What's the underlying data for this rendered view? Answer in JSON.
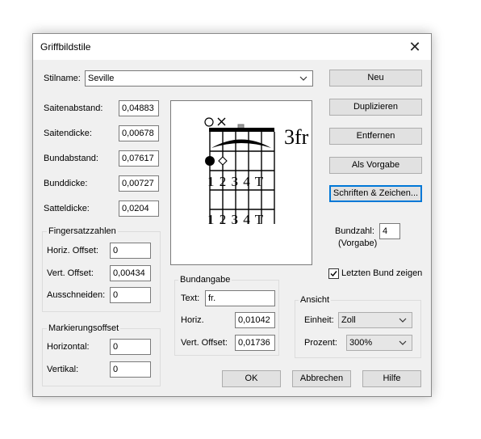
{
  "window": {
    "title": "Griffbildstile"
  },
  "style_name": {
    "label": "Stilname:",
    "value": "Seville"
  },
  "metrics": [
    {
      "label": "Saitenabstand:",
      "value": "0,04883"
    },
    {
      "label": "Saitendicke:",
      "value": "0,00678"
    },
    {
      "label": "Bundabstand:",
      "value": "0,07617"
    },
    {
      "label": "Bunddicke:",
      "value": "0,00727"
    },
    {
      "label": "Satteldicke:",
      "value": "0,0204"
    }
  ],
  "fingering": {
    "title": "Fingersatzzahlen",
    "horiz_label": "Horiz. Offset:",
    "horiz_value": "0",
    "vert_label": "Vert. Offset:",
    "vert_value": "0,00434",
    "cut_label": "Ausschneiden:",
    "cut_value": "0"
  },
  "marking": {
    "title": "Markierungsoffset",
    "horiz_label": "Horizontal:",
    "horiz_value": "0",
    "vert_label": "Vertikal:",
    "vert_value": "0"
  },
  "fret_label": {
    "title": "Bundangabe",
    "text_label": "Text:",
    "text_value": "fr.",
    "horiz_label": "Horiz.",
    "horiz_value": "0,01042",
    "vert_label": "Vert. Offset:",
    "vert_value": "0,01736"
  },
  "buttons": {
    "new": "Neu",
    "duplicate": "Duplizieren",
    "remove": "Entfernen",
    "default": "Als Vorgabe",
    "fonts": "Schriften & Zeichen...",
    "ok": "OK",
    "cancel": "Abbrechen",
    "help": "Hilfe"
  },
  "fret_count": {
    "label": "Bundzahl:",
    "value": "4",
    "note": "(Vorgabe)"
  },
  "last_fret": {
    "label": "Letzten Bund zeigen",
    "checked": true
  },
  "view": {
    "title": "Ansicht",
    "unit_label": "Einheit:",
    "unit_value": "Zoll",
    "percent_label": "Prozent:",
    "percent_value": "300%"
  },
  "preview": {
    "fret_text": "3fr",
    "finger_row_top": "1 2 3 4 T",
    "finger_row_bottom": "1 2 3 4 T"
  }
}
